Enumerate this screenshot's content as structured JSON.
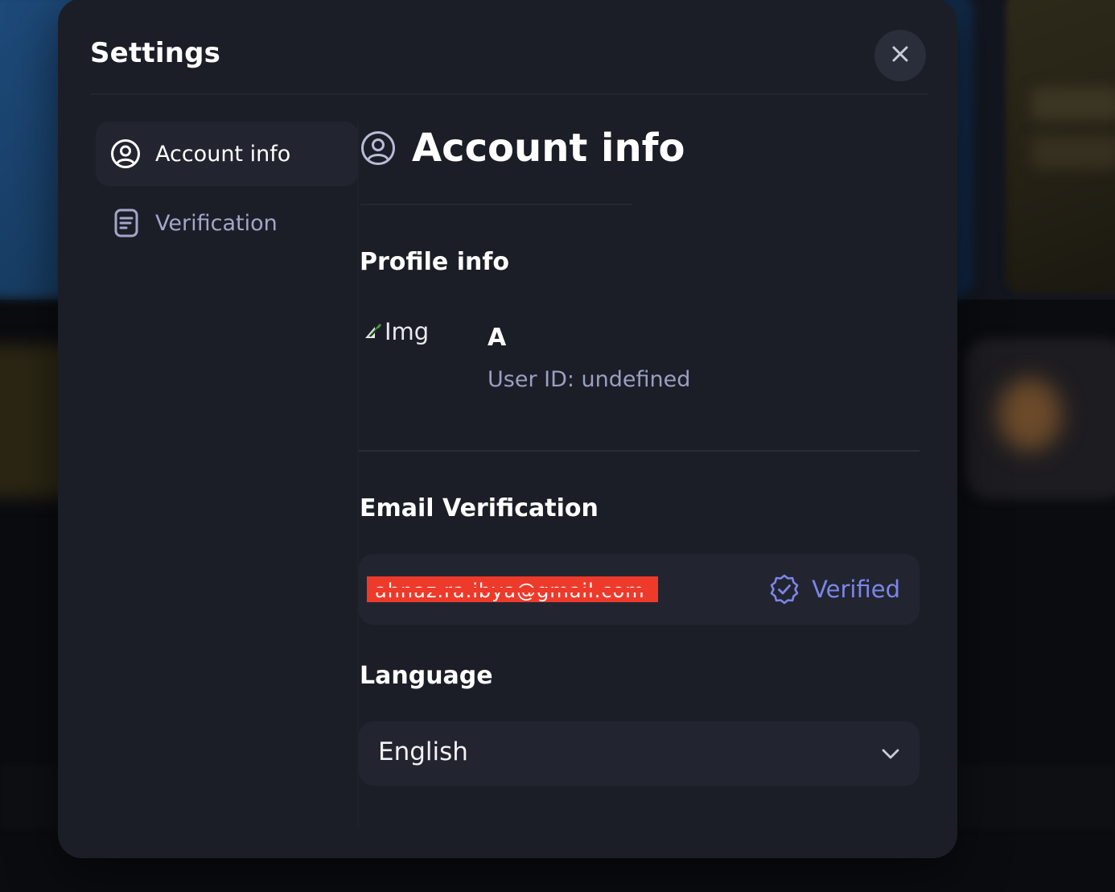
{
  "modal": {
    "title": "Settings",
    "close_icon": "close-icon"
  },
  "sidebar": {
    "items": [
      {
        "label": "Account info",
        "icon": "user-circle-icon",
        "active": true
      },
      {
        "label": "Verification",
        "icon": "document-icon",
        "active": false
      }
    ]
  },
  "content": {
    "heading": "Account info",
    "heading_icon": "user-circle-icon",
    "profile": {
      "section_title": "Profile info",
      "avatar_alt": "Img",
      "display_initial": "A",
      "user_id": "User ID: undefined"
    },
    "email": {
      "section_title": "Email Verification",
      "address": "ahnaz.ra.ibya@gmail.com",
      "status_label": "Verified",
      "status_icon": "verified-badge-icon"
    },
    "language": {
      "section_title": "Language",
      "selected": "English",
      "dropdown_icon": "chevron-down-icon"
    }
  },
  "colors": {
    "modal_bg": "#1b1e27",
    "panel_bg": "#222530",
    "accent": "#7c86e8",
    "muted_text": "#9b9fc1",
    "redaction": "#ee3a2a"
  }
}
